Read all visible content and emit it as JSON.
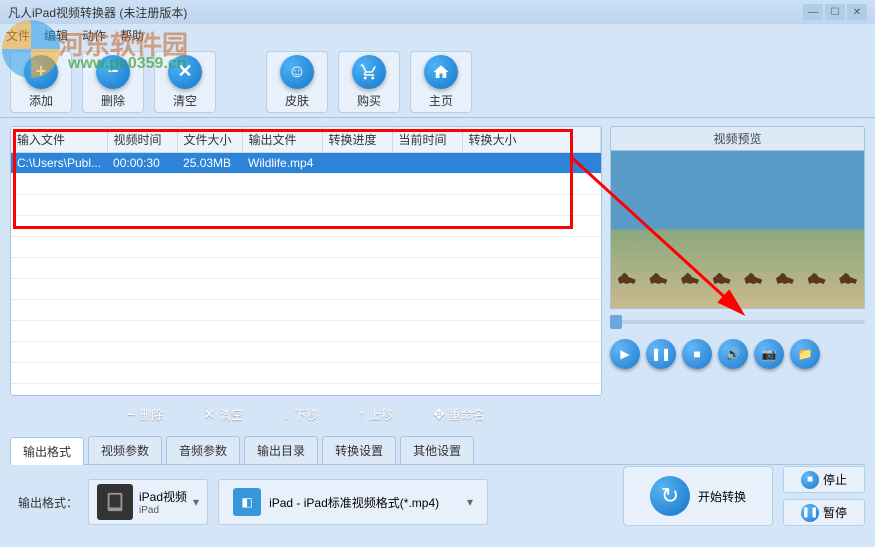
{
  "title": "凡人iPad视频转换器   (未注册版本)",
  "menu": {
    "file": "文件",
    "edit": "编辑",
    "action": "动作",
    "help": "帮助"
  },
  "watermark": {
    "text": "河东软件园",
    "url": "www.pc0359.cn"
  },
  "toolbar": {
    "add": "添加",
    "delete": "删除",
    "clear": "清空",
    "skin": "皮肤",
    "buy": "购买",
    "home": "主页"
  },
  "columns": {
    "input": "输入文件",
    "duration": "视频时间",
    "size": "文件大小",
    "output": "输出文件",
    "progress": "转换进度",
    "curtime": "当前时间",
    "convsize": "转换大小"
  },
  "rows": [
    {
      "input": "C:\\Users\\Publ...",
      "duration": "00:00:30",
      "size": "25.03MB",
      "output": "Wildlife.mp4",
      "progress": "",
      "curtime": "",
      "convsize": ""
    }
  ],
  "listActions": {
    "delete": "删除",
    "clear": "清空",
    "down": "下移",
    "up": "上移",
    "rename": "重命名"
  },
  "preview": {
    "title": "视频预览"
  },
  "tabs": {
    "format": "输出格式",
    "video": "视频参数",
    "audio": "音频参数",
    "outdir": "输出目录",
    "conv": "转换设置",
    "other": "其他设置"
  },
  "output": {
    "label": "输出格式：",
    "device": "iPad视频",
    "deviceSub": "iPad",
    "format": "iPad - iPad标准视频格式(*.mp4)"
  },
  "convert": {
    "start": "开始转换",
    "stop": "停止",
    "pause": "暂停"
  }
}
